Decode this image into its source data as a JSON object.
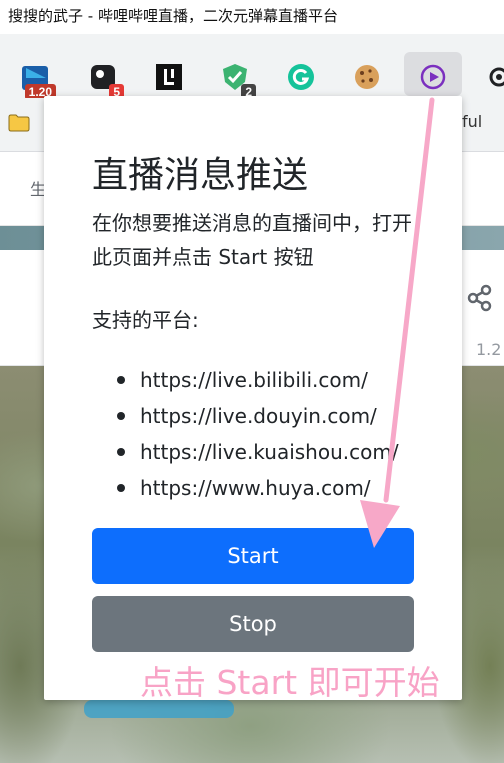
{
  "browser": {
    "window_title": "搜搜的武子 - 哔哩哔哩直播，二次元弹幕直播平台",
    "extensions": [
      {
        "name": "extension-1",
        "badge": "1.20",
        "badge_color": "#c0392b"
      },
      {
        "name": "extension-2",
        "badge": "5",
        "badge_color": "#e53935"
      },
      {
        "name": "extension-3",
        "badge": ""
      },
      {
        "name": "extension-4",
        "badge": "2",
        "badge_color": "#444444"
      },
      {
        "name": "grammarly",
        "badge": ""
      },
      {
        "name": "cookie",
        "badge": ""
      },
      {
        "name": "live-push",
        "badge": ""
      },
      {
        "name": "puzzle",
        "badge": ""
      }
    ],
    "bookmark_partial_text": "ful"
  },
  "page": {
    "nav_partial": "生",
    "info_number": "1.2"
  },
  "popup": {
    "title": "直播消息推送",
    "description": "在你想要推送消息的直播间中，打开此页面并点击 Start 按钮",
    "platforms_label": "支持的平台:",
    "platforms": [
      "https://live.bilibili.com/",
      "https://live.douyin.com/",
      "https://live.kuaishou.com/",
      "https://www.huya.com/"
    ],
    "start_label": "Start",
    "stop_label": "Stop",
    "colors": {
      "start": "#0d6efd",
      "stop": "#6c757d"
    }
  },
  "annotation": {
    "text": "点击 Start 即可开始",
    "color": "#f8a3c6"
  }
}
